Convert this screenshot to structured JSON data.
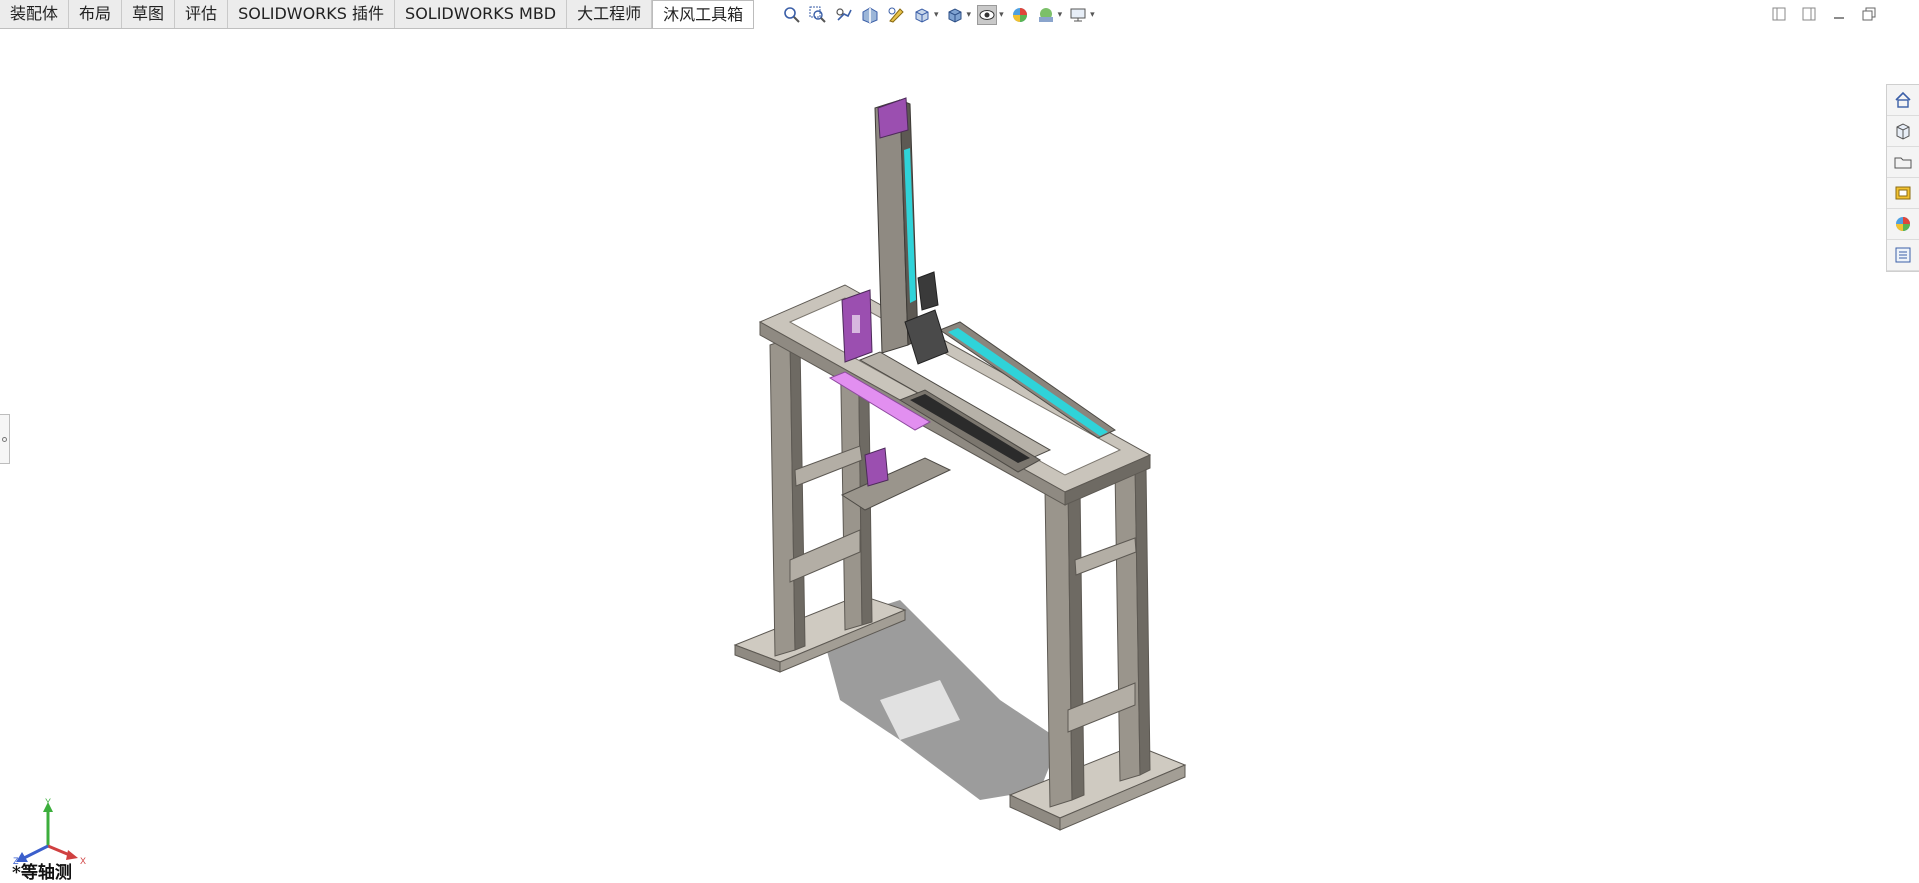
{
  "tabs": [
    {
      "label": "装配体",
      "active": false
    },
    {
      "label": "布局",
      "active": false
    },
    {
      "label": "草图",
      "active": false
    },
    {
      "label": "评估",
      "active": false
    },
    {
      "label": "SOLIDWORKS 插件",
      "active": false
    },
    {
      "label": "SOLIDWORKS MBD",
      "active": false
    },
    {
      "label": "大工程师",
      "active": false
    },
    {
      "label": "沐风工具箱",
      "active": true
    }
  ],
  "heads_up_toolbar": [
    "zoom-to-fit-icon",
    "zoom-to-area-icon",
    "previous-view-icon",
    "section-view-icon",
    "dynamic-annotation-icon",
    "view-orientation-icon",
    "display-style-icon",
    "hide-show-items-icon",
    "edit-appearance-icon",
    "apply-scene-icon",
    "view-settings-icon"
  ],
  "task_pane": [
    "home-icon",
    "design-library-icon",
    "file-explorer-icon",
    "view-palette-icon",
    "appearances-icon",
    "custom-properties-icon"
  ],
  "view": {
    "label": "*等轴测",
    "axes": {
      "x": "X",
      "y": "Y",
      "z": "Z"
    }
  },
  "colors": {
    "frame": "#8f8a82",
    "frame_dark": "#5d5953",
    "frame_light": "#c9c4bb",
    "accent_purple": "#9b4fb0",
    "accent_magenta": "#e28ff0",
    "accent_cyan": "#2fd3d9",
    "shadow": "#3a3a3a"
  }
}
